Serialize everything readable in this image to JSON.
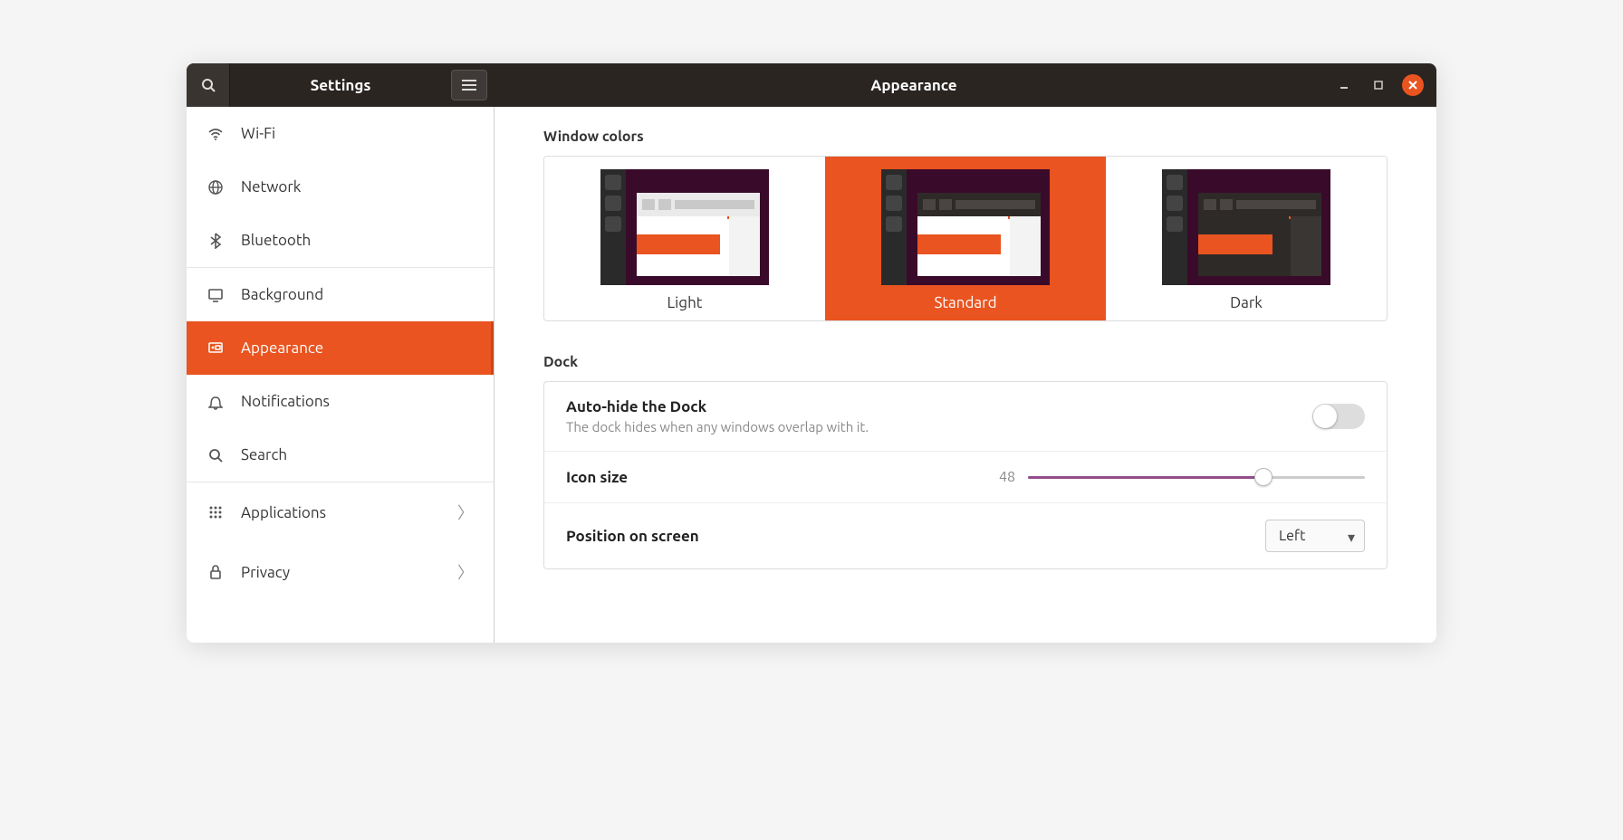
{
  "titlebar": {
    "left_title": "Settings",
    "right_title": "Appearance"
  },
  "sidebar": {
    "items": [
      {
        "label": "Wi-Fi",
        "icon": "wifi-icon"
      },
      {
        "label": "Network",
        "icon": "globe-icon"
      },
      {
        "label": "Bluetooth",
        "icon": "bluetooth-icon"
      },
      {
        "label": "Background",
        "icon": "display-icon"
      },
      {
        "label": "Appearance",
        "icon": "appearance-icon"
      },
      {
        "label": "Notifications",
        "icon": "bell-icon"
      },
      {
        "label": "Search",
        "icon": "search-icon"
      },
      {
        "label": "Applications",
        "icon": "grid-icon"
      },
      {
        "label": "Privacy",
        "icon": "lock-icon"
      }
    ]
  },
  "window_colors": {
    "heading": "Window colors",
    "options": [
      {
        "label": "Light"
      },
      {
        "label": "Standard"
      },
      {
        "label": "Dark"
      }
    ],
    "selected": "Standard"
  },
  "dock": {
    "heading": "Dock",
    "autohide": {
      "title": "Auto-hide the Dock",
      "subtitle": "The dock hides when any windows overlap with it.",
      "value": false
    },
    "icon_size": {
      "title": "Icon size",
      "value": 48
    },
    "position": {
      "title": "Position on screen",
      "value": "Left"
    }
  },
  "colors": {
    "accent": "#e95420",
    "slider": "#924d8b"
  }
}
